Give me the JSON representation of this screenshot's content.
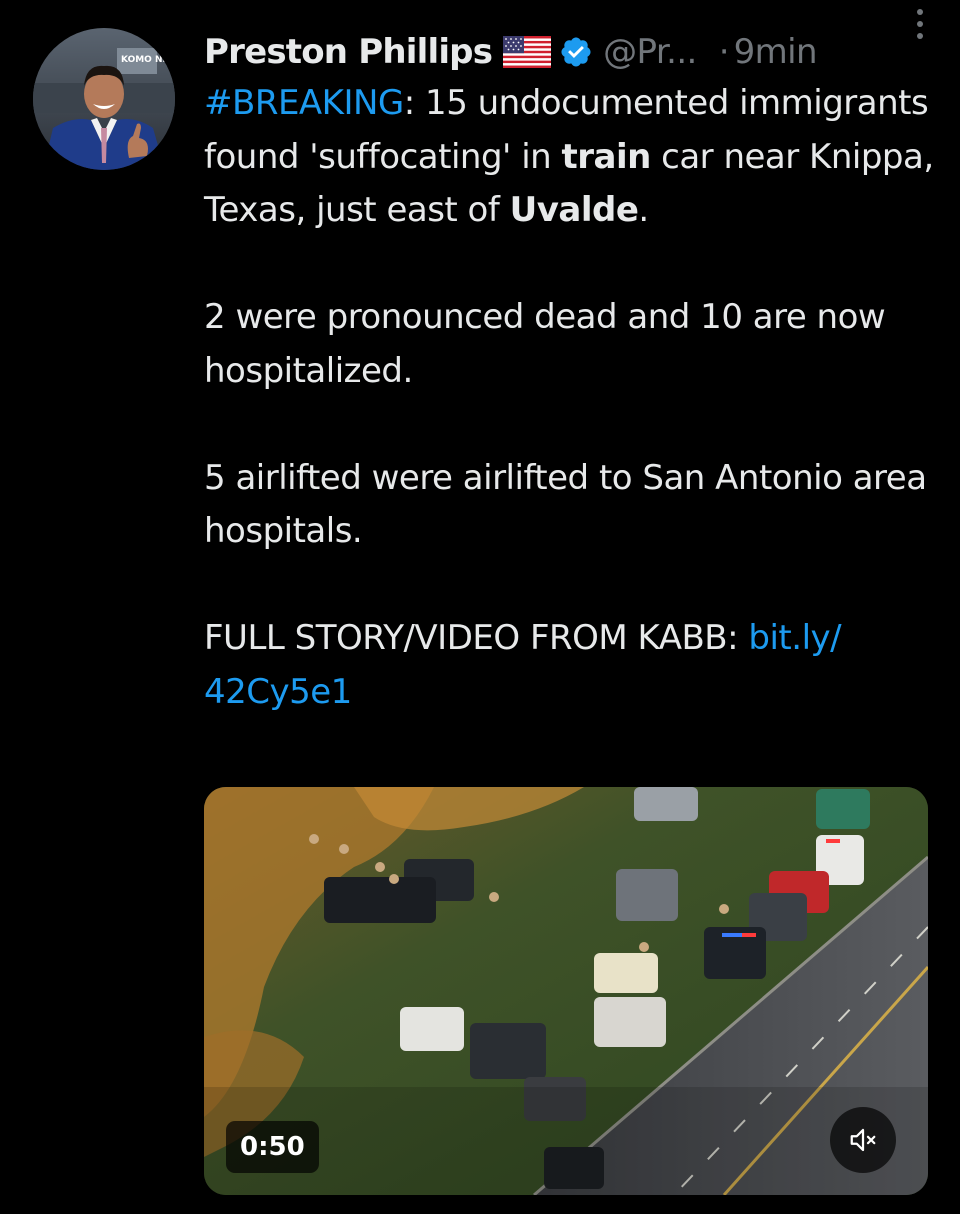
{
  "author": {
    "display_name": "Preston Phillips",
    "flag_emoji": "🇺🇸",
    "handle": "@Pr...",
    "separator": "·",
    "time": "9min",
    "avatar_badge_text": "KOMO NEWS"
  },
  "tweet": {
    "hashtag": "#BREAKING",
    "p1_after_hashtag": ":  15 undocumented immigrants found 'suffocating' in ",
    "p1_bold_1": "train",
    "p1_mid": " car near Knippa, Texas, just east of ",
    "p1_bold_2": "Uvalde",
    "p1_end": ".",
    "p2": "2 were pronounced dead and 10 are now hospitalized.",
    "p3": "5 airlifted were airlifted to San Antonio area hospitals.",
    "p4_text": "FULL STORY/VIDEO FROM KABB: ",
    "p4_link": "bit.ly/ 42Cy5e1"
  },
  "media": {
    "duration": "0:50",
    "mute_icon": "speaker-muted-icon"
  },
  "colors": {
    "background": "#000000",
    "text": "#e7e9ea",
    "secondary": "#71767b",
    "link": "#1d9bf0",
    "verified": "#1d9bf0"
  },
  "icons": {
    "verified": "verified-badge-icon",
    "flag": "us-flag-icon",
    "more": "more-vertical-icon"
  }
}
